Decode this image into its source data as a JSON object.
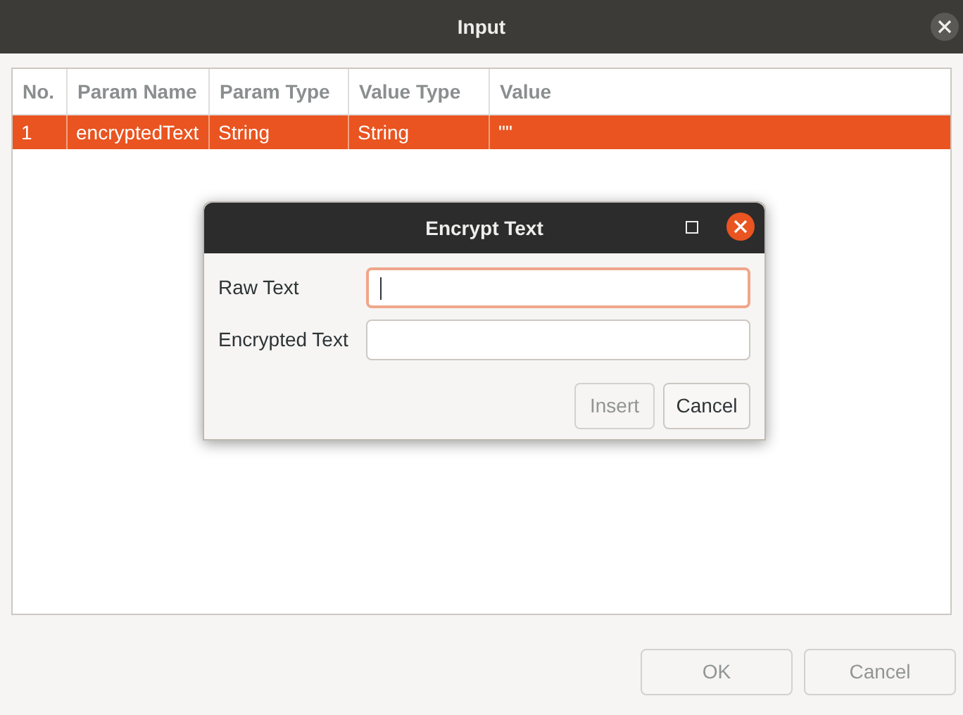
{
  "window": {
    "title": "Input"
  },
  "table": {
    "columns": [
      "No.",
      "Param Name",
      "Param Type",
      "Value Type",
      "Value"
    ],
    "rows": [
      {
        "cells": [
          "1",
          "encryptedText",
          "String",
          "String",
          "\"\""
        ],
        "selected": true
      }
    ]
  },
  "buttons": [
    {
      "label": "OK",
      "disabled": true
    },
    {
      "label": "Cancel",
      "disabled": true
    }
  ],
  "dialog": {
    "title": "Encrypt Text",
    "fields": [
      {
        "label": "Raw Text",
        "focused": true
      },
      {
        "label": "Encrypted Text",
        "focused": false
      }
    ],
    "buttons": [
      {
        "label": "Insert",
        "disabled": true
      },
      {
        "label": "Cancel",
        "disabled": false
      }
    ]
  }
}
